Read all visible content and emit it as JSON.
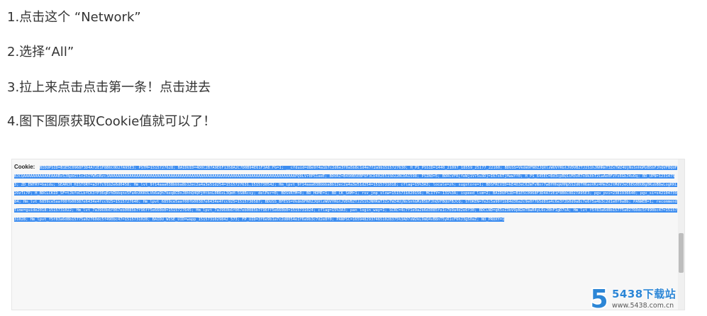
{
  "steps": [
    {
      "text": "1.点击这个 “Network”"
    },
    {
      "text": "2.选择“All”"
    },
    {
      "text": "3.拉上来点击点击第一条！点击进去"
    },
    {
      "text": "4.图下图原获取Cookie值就可以了！"
    }
  ],
  "screenshot": {
    "cookie_label": "Cookie:",
    "cookie_value": "BIDUPSID=B1E5C0968F3D4A72E1F8B6C0D27A95E3; PSTM=1515727628; BAIDUID=4D0C2B7A9E6F1358A2C7D0B94E61F3A8:FG=1; __cfduid=d8e9f4a1b7c2d6e3f0a5b8c1d4e7f2a9b1515727630; H_PS_PSSID=1440_21097_18559_25177_22160; BDUSS=Vkdm9FN0ZJQXlzWUVYRGtJVDVBZTJ2S1hJNHRmT3ZxTWZ4UjNsSnhGMzB5bFJhQVFBQUFBJCQAAAAAAAAAAAEAAABxSJ8pbGl1c2h1YW5nNzc3AAAAAAAAAAAAAAAAAAAAAAAAAAAAAAAAAAAAAAAAAAAAAAAAAAAAAAAAAAAAAAAAAAAAAAAAAAAAAAAAAPQ9LVr0PS1aeE; BDORZ=B490B5EBF6F3CD402E515D22BCDA1598; PSINO=5; BDRCVFR[feWj1Vr5u3D]=I67x6TjHwwYf0; H_PS_645EC=8d3cpBQ1iM3vR7n9kXhT2LwAe0FzYs6GbJ4uOq; BD_UPN=12314753; ZD_ENTRY=baidu; SEARCH_HISTORY=a3f7c91b2e6d0458; Hm_lvt_9f14aaa038bbba8b12ec2a4a3e51d254=1515727631,1515730542; Hm_lpvt_9f14aaa038bbba8b12ec2a4a3e51d254=1515731018; cflag=15%3A3; locale=zh; sugstore=1; BDSFRCVID=kE4OJeC62mFvNxr7w8fHhqkHHp5S2d6TH6aoVKz4HeZx2tMdVJeC6EG0DU8g0KubB8wLogKKL2OzTi7P; H_BDCLCKID_SF=tJkfoCLbfCK3fP36qRrhDbbqnx5Fa4nXKKOLVb6aQh7keq8CDxJ8hhQ4QPjHtbnL0R6xL3QmH-5S8Rcsy; delPer=0; BDSVRTM=0; BD_HOME=1; BD_CK_SAM=1; rsv_jmp_slow=1515731020156; MCITY=-131%3A; ispeed_lsm=2; BAIDUPSID=B1E5C0968F3D4A72E1F8B6C0D27A95E3; pgv_pvi=2381936640; pgv_si=s4210473984; Hm_lvt_6859ce5aaf00fb00387e6434e4fcc925=1515727640; Hm_lpvt_6859ce5aaf00fb00387e6434e4fcc925=1515730587; BDUSS_BFESS=Vkdm9FN0ZJQXlzWUVYRGtJVDVBZTJ2S1hJNHRmT3ZxTWZ4UjNsSnhGMzB5bFJhQVFBQUFBJCQ; STOKEN=7e2c5a90f1b84d36a2c9e0f7b5d81a4c6e3f2b0d9a8c7e6f5a4b3c2d1e0f9a8b; PANWEB=1; recommendTime=guide2018:1515731022; Hm_lvt_7a3960b6f067eb0085b7f96ff5e660b0=1515727645; Hm_lpvt_7a3960b6f067eb0085b7f96ff5e660b0=1515731024; cflag=15%3A3; pan_login_way=1; SCRC=4c7f1e9a2b6d3085fe1c7b9a4d2e6f30; BDCLND=qK5xZ3bV9pN2mT8wR4yL6cJ0hF1gD7sA; Hm_lvt_f5f83a6d8b15775a02760dc5f490bc47=1515731028; Hm_lpvt_f5f83a6d8b15775a02760dc5f490bc47=1515731028; BAIDU_WISE_UID=wapp_1515731029842_573; FP_UID=3f6e9b1a7c2d8054e1f6a9b3c7d2e8f0; PANPSC=16594829374651028375%3AD7xW2kL9mQ4vB8nT5yR1cF6hJ3gS0aZ; NO_PROXY=1"
  },
  "watermark": {
    "logo_glyph": "5",
    "name": "5438下载站",
    "url": "www.5438.com.cn",
    "brand_color": "#2c86d6"
  }
}
